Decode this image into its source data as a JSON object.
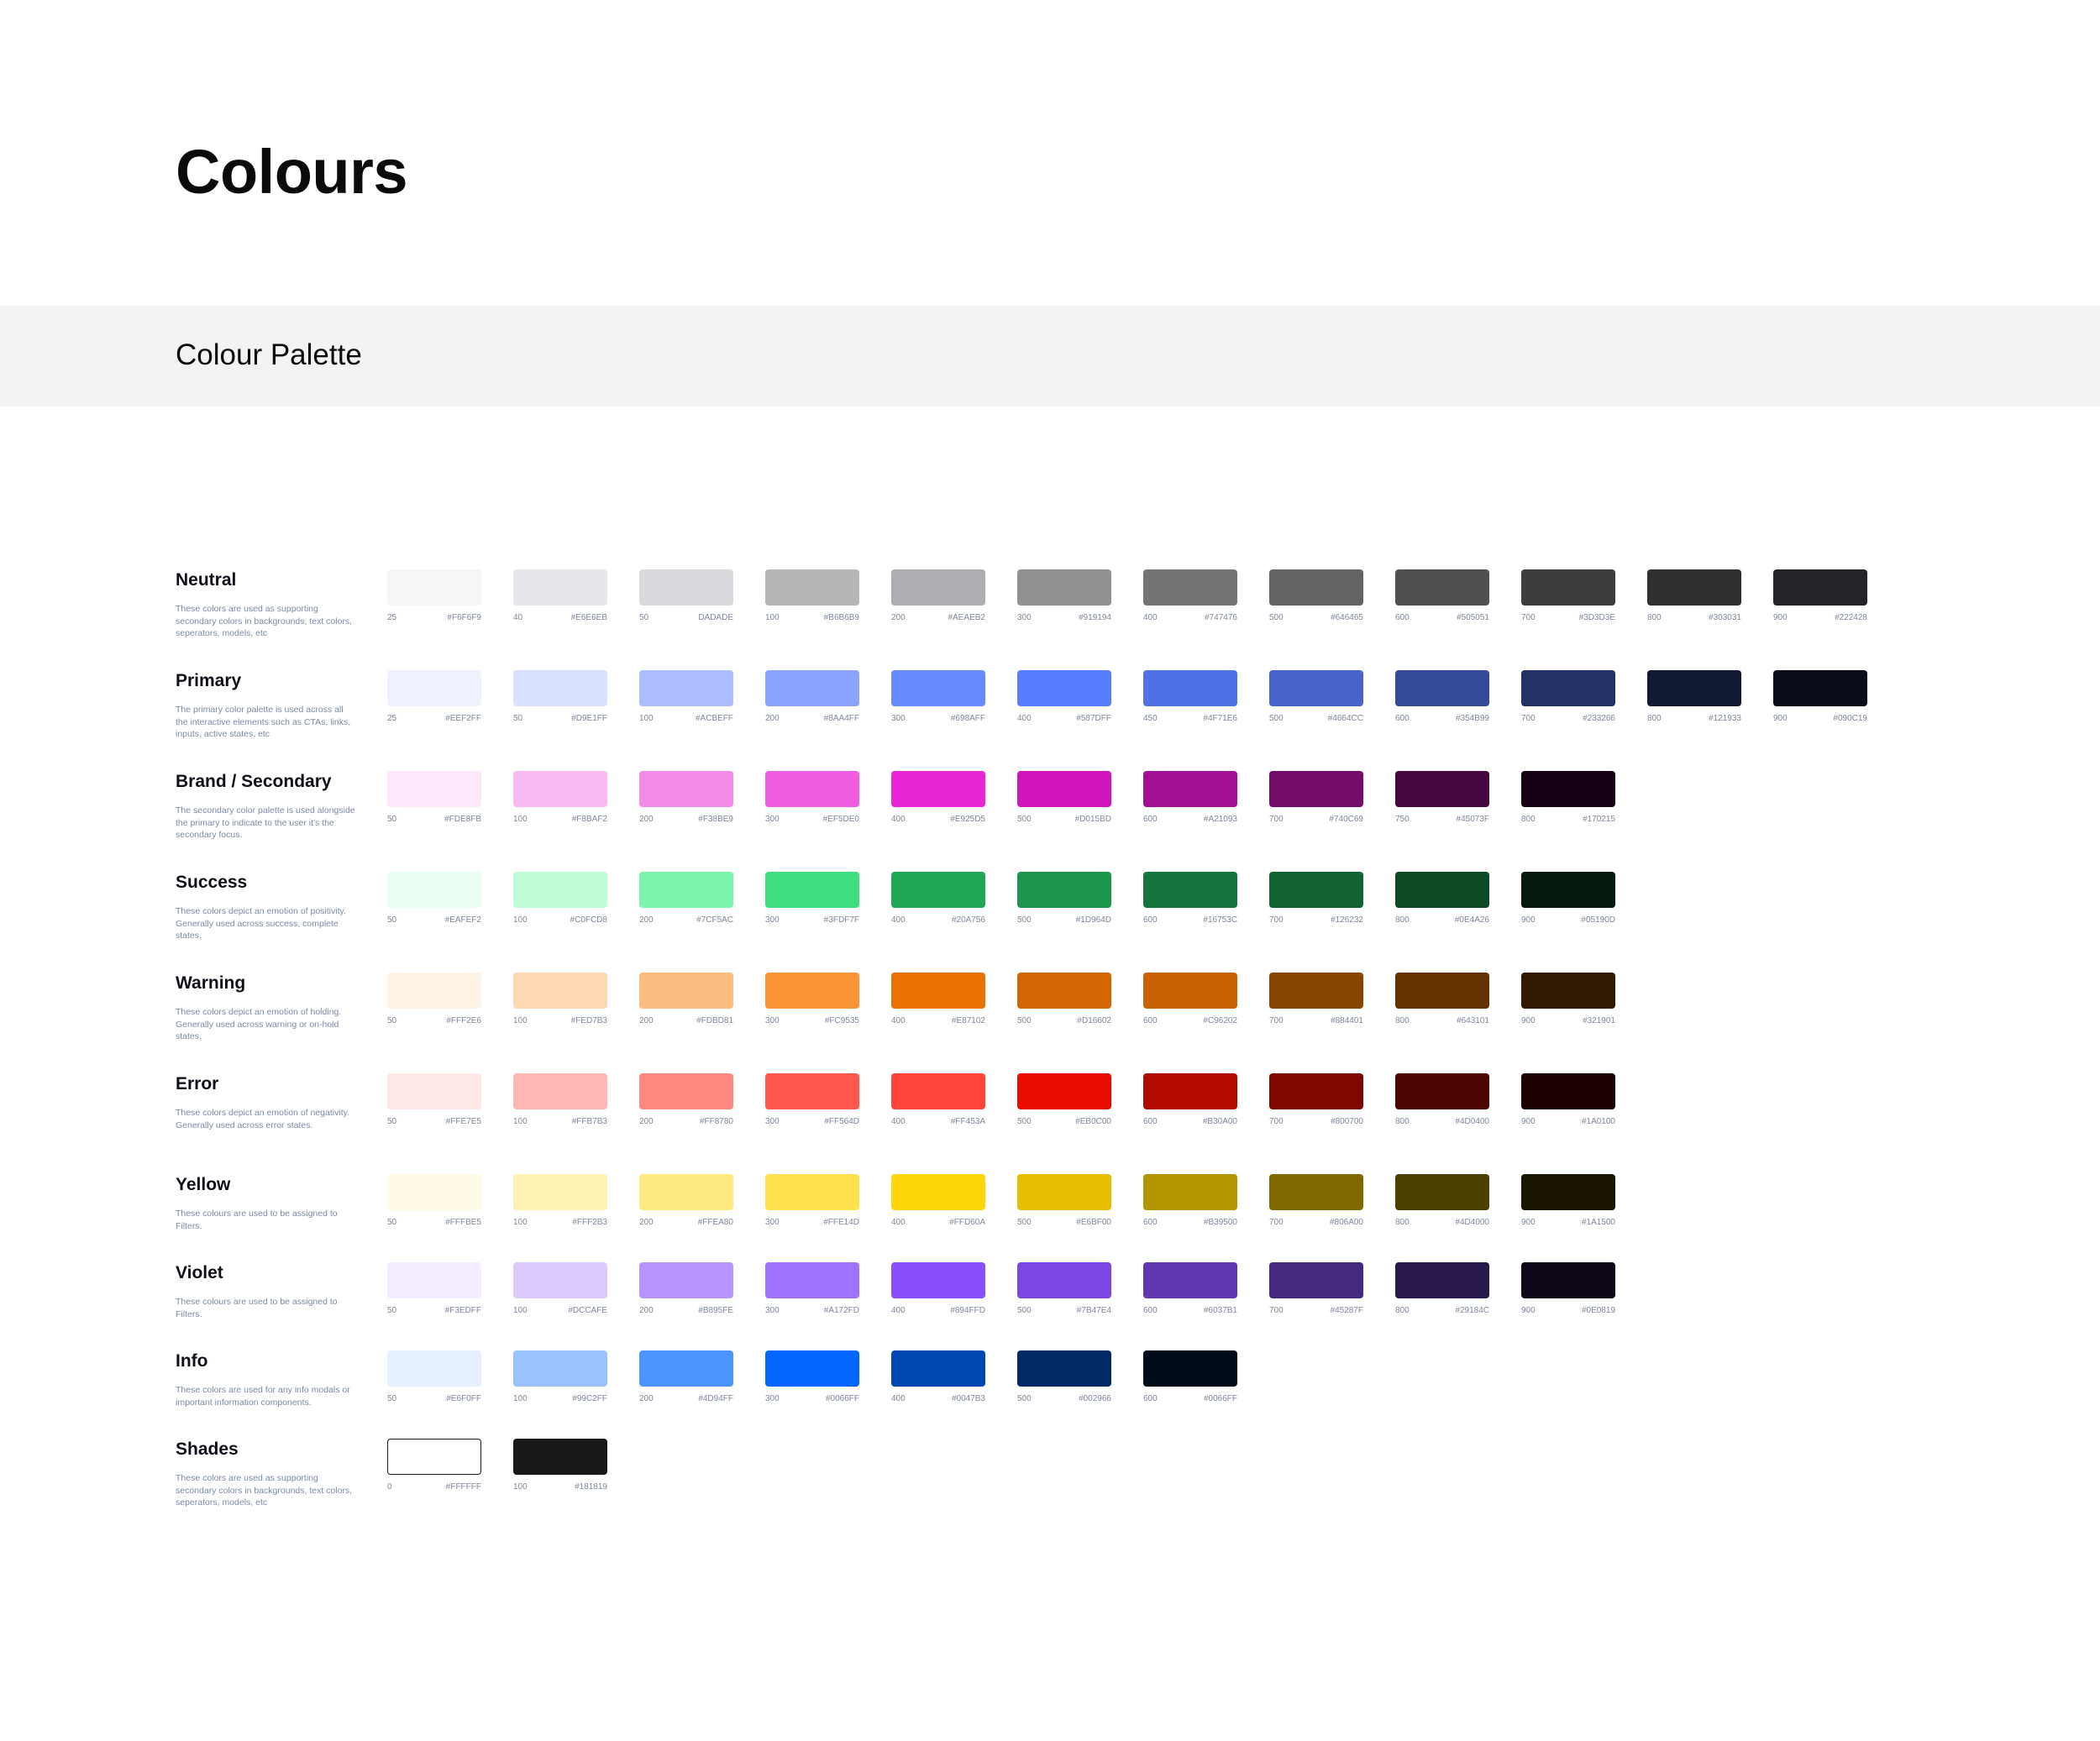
{
  "page_title": "Colours",
  "section_title": "Colour Palette",
  "palettes": [
    {
      "name": "Neutral",
      "description": "These colors are used as supporting secondary colors in backgrounds, text colors, seperators, models, etc",
      "swatches": [
        {
          "step": "25",
          "hex": "#F6F6F9",
          "color": "#F6F6F9"
        },
        {
          "step": "40",
          "hex": "#E6E6EB",
          "color": "#E6E6EB"
        },
        {
          "step": "50",
          "hex": "DADADE",
          "color": "#DADADE"
        },
        {
          "step": "100",
          "hex": "#B6B6B9",
          "color": "#B6B6B9"
        },
        {
          "step": "200",
          "hex": "#AEAEB2",
          "color": "#AEAEB2"
        },
        {
          "step": "300",
          "hex": "#919194",
          "color": "#919194"
        },
        {
          "step": "400",
          "hex": "#747476",
          "color": "#747476"
        },
        {
          "step": "500",
          "hex": "#646465",
          "color": "#646465"
        },
        {
          "step": "600",
          "hex": "#505051",
          "color": "#505051"
        },
        {
          "step": "700",
          "hex": "#3D3D3E",
          "color": "#3D3D3E"
        },
        {
          "step": "800",
          "hex": "#303031",
          "color": "#303031"
        },
        {
          "step": "900",
          "hex": "#222428",
          "color": "#222428"
        }
      ]
    },
    {
      "name": "Primary",
      "description": "The primary color palette is used across all the interactive elements such as CTAs, links, inputs, active states, etc",
      "swatches": [
        {
          "step": "25",
          "hex": "#EEF2FF",
          "color": "#EEF2FF"
        },
        {
          "step": "50",
          "hex": "#D9E1FF",
          "color": "#D9E1FF"
        },
        {
          "step": "100",
          "hex": "#ACBEFF",
          "color": "#ACBEFF"
        },
        {
          "step": "200",
          "hex": "#8AA4FF",
          "color": "#8AA4FF"
        },
        {
          "step": "300",
          "hex": "#698AFF",
          "color": "#698AFF"
        },
        {
          "step": "400",
          "hex": "#587DFF",
          "color": "#587DFF"
        },
        {
          "step": "450",
          "hex": "#4F71E6",
          "color": "#4F71E6"
        },
        {
          "step": "500",
          "hex": "#4664CC",
          "color": "#4664CC"
        },
        {
          "step": "600",
          "hex": "#354B99",
          "color": "#354B99"
        },
        {
          "step": "700",
          "hex": "#233266",
          "color": "#233266"
        },
        {
          "step": "800",
          "hex": "#121933",
          "color": "#121933"
        },
        {
          "step": "900",
          "hex": "#090C19",
          "color": "#090C19"
        }
      ]
    },
    {
      "name": "Brand / Secondary",
      "description": "The secondary color palette is used alongside the primary to indicate to the user it's the secondary focus.",
      "swatches": [
        {
          "step": "50",
          "hex": "#FDE8FB",
          "color": "#FDE8FB"
        },
        {
          "step": "100",
          "hex": "#F8BAF2",
          "color": "#F8BAF2"
        },
        {
          "step": "200",
          "hex": "#F38BE9",
          "color": "#F38BE9"
        },
        {
          "step": "300",
          "hex": "#EF5DE0",
          "color": "#EF5DE0"
        },
        {
          "step": "400",
          "hex": "#E925D5",
          "color": "#E925D5"
        },
        {
          "step": "500",
          "hex": "#D015BD",
          "color": "#D015BD"
        },
        {
          "step": "600",
          "hex": "#A21093",
          "color": "#A21093"
        },
        {
          "step": "700",
          "hex": "#740C69",
          "color": "#740C69"
        },
        {
          "step": "750",
          "hex": "#45073F",
          "color": "#45073F"
        },
        {
          "step": "800",
          "hex": "#170215",
          "color": "#170215"
        }
      ]
    },
    {
      "name": "Success",
      "description": "These colors depict an emotion of positivity. Generally used across success, complete states.",
      "swatches": [
        {
          "step": "50",
          "hex": "#EAFEF2",
          "color": "#EAFEF2"
        },
        {
          "step": "100",
          "hex": "#C0FCD8",
          "color": "#C0FCD8"
        },
        {
          "step": "200",
          "hex": "#7CF5AC",
          "color": "#7CF5AC"
        },
        {
          "step": "300",
          "hex": "#3FDF7F",
          "color": "#3FDF7F"
        },
        {
          "step": "400",
          "hex": "#20A756",
          "color": "#20A756"
        },
        {
          "step": "500",
          "hex": "#1D964D",
          "color": "#1D964D"
        },
        {
          "step": "600",
          "hex": "#16753C",
          "color": "#16753C"
        },
        {
          "step": "700",
          "hex": "#126232",
          "color": "#126232"
        },
        {
          "step": "800",
          "hex": "#0E4A26",
          "color": "#0E4A26"
        },
        {
          "step": "900",
          "hex": "#05190D",
          "color": "#05190D"
        }
      ]
    },
    {
      "name": "Warning",
      "description": "These colors depict an emotion of holding. Generally used across warning or on-hold states.",
      "swatches": [
        {
          "step": "50",
          "hex": "#FFF2E6",
          "color": "#FFF2E6"
        },
        {
          "step": "100",
          "hex": "#FED7B3",
          "color": "#FED7B3"
        },
        {
          "step": "200",
          "hex": "#FDBD81",
          "color": "#FDBD81"
        },
        {
          "step": "300",
          "hex": "#FC9535",
          "color": "#FC9535"
        },
        {
          "step": "400",
          "hex": "#E87102",
          "color": "#E87102"
        },
        {
          "step": "500",
          "hex": "#D16602",
          "color": "#D16602"
        },
        {
          "step": "600",
          "hex": "#C96202",
          "color": "#C96202"
        },
        {
          "step": "700",
          "hex": "#884401",
          "color": "#884401"
        },
        {
          "step": "800",
          "hex": "#643101",
          "color": "#643101"
        },
        {
          "step": "900",
          "hex": "#321901",
          "color": "#321901"
        }
      ]
    },
    {
      "name": "Error",
      "description": "These colors depict an emotion of negativity. Generally used across error states.",
      "swatches": [
        {
          "step": "50",
          "hex": "#FFE7E5",
          "color": "#FFE7E5"
        },
        {
          "step": "100",
          "hex": "#FFB7B3",
          "color": "#FFB7B3"
        },
        {
          "step": "200",
          "hex": "#FF8780",
          "color": "#FF8780"
        },
        {
          "step": "300",
          "hex": "#FF564D",
          "color": "#FF564D"
        },
        {
          "step": "400",
          "hex": "#FF453A",
          "color": "#FF453A"
        },
        {
          "step": "500",
          "hex": "#EB0C00",
          "color": "#EB0C00"
        },
        {
          "step": "600",
          "hex": "#B30A00",
          "color": "#B30A00"
        },
        {
          "step": "700",
          "hex": "#800700",
          "color": "#800700"
        },
        {
          "step": "800",
          "hex": "#4D0400",
          "color": "#4D0400"
        },
        {
          "step": "900",
          "hex": "#1A0100",
          "color": "#1A0100"
        }
      ]
    },
    {
      "name": "Yellow",
      "description": "These colours are used to be assigned to Filters.",
      "swatches": [
        {
          "step": "50",
          "hex": "#FFFBE5",
          "color": "#FFFBE5"
        },
        {
          "step": "100",
          "hex": "#FFF2B3",
          "color": "#FFF2B3"
        },
        {
          "step": "200",
          "hex": "#FFEA80",
          "color": "#FFEA80"
        },
        {
          "step": "300",
          "hex": "#FFE14D",
          "color": "#FFE14D"
        },
        {
          "step": "400",
          "hex": "#FFD60A",
          "color": "#FFD60A"
        },
        {
          "step": "500",
          "hex": "#E6BF00",
          "color": "#E6BF00"
        },
        {
          "step": "600",
          "hex": "#B39500",
          "color": "#B39500"
        },
        {
          "step": "700",
          "hex": "#806A00",
          "color": "#806A00"
        },
        {
          "step": "800",
          "hex": "#4D4000",
          "color": "#4D4000"
        },
        {
          "step": "900",
          "hex": "#1A1500",
          "color": "#1A1500"
        }
      ]
    },
    {
      "name": "Violet",
      "description": "These colours are used to be assigned to Filters.",
      "swatches": [
        {
          "step": "50",
          "hex": "#F3EDFF",
          "color": "#F3EDFF"
        },
        {
          "step": "100",
          "hex": "#DCCAFE",
          "color": "#DCCAFE"
        },
        {
          "step": "200",
          "hex": "#B895FE",
          "color": "#B895FE"
        },
        {
          "step": "300",
          "hex": "#A172FD",
          "color": "#A172FD"
        },
        {
          "step": "400",
          "hex": "#894FFD",
          "color": "#894FFD"
        },
        {
          "step": "500",
          "hex": "#7B47E4",
          "color": "#7B47E4"
        },
        {
          "step": "600",
          "hex": "#6037B1",
          "color": "#6037B1"
        },
        {
          "step": "700",
          "hex": "#45287F",
          "color": "#45287F"
        },
        {
          "step": "800",
          "hex": "#29184C",
          "color": "#29184C"
        },
        {
          "step": "900",
          "hex": "#0E0819",
          "color": "#0E0819"
        }
      ]
    },
    {
      "name": "Info",
      "description": "These colors are used for any info modals or important information components.",
      "swatches": [
        {
          "step": "50",
          "hex": "#E6F0FF",
          "color": "#E6F0FF"
        },
        {
          "step": "100",
          "hex": "#99C2FF",
          "color": "#99C2FF"
        },
        {
          "step": "200",
          "hex": "#4D94FF",
          "color": "#4D94FF"
        },
        {
          "step": "300",
          "hex": "#0066FF",
          "color": "#0066FF"
        },
        {
          "step": "400",
          "hex": "#0047B3",
          "color": "#0047B3"
        },
        {
          "step": "500",
          "hex": "#002966",
          "color": "#002966"
        },
        {
          "step": "600",
          "hex": "#0066FF",
          "color": "#000A19"
        }
      ]
    },
    {
      "name": "Shades",
      "description": "These colors are used as supporting secondary colors in backgrounds, text colors, seperators, models, etc",
      "swatches": [
        {
          "step": "0",
          "hex": "#FFFFFF",
          "color": "#FFFFFF",
          "outlined": true
        },
        {
          "step": "100",
          "hex": "#181819",
          "color": "#181819"
        }
      ]
    }
  ]
}
